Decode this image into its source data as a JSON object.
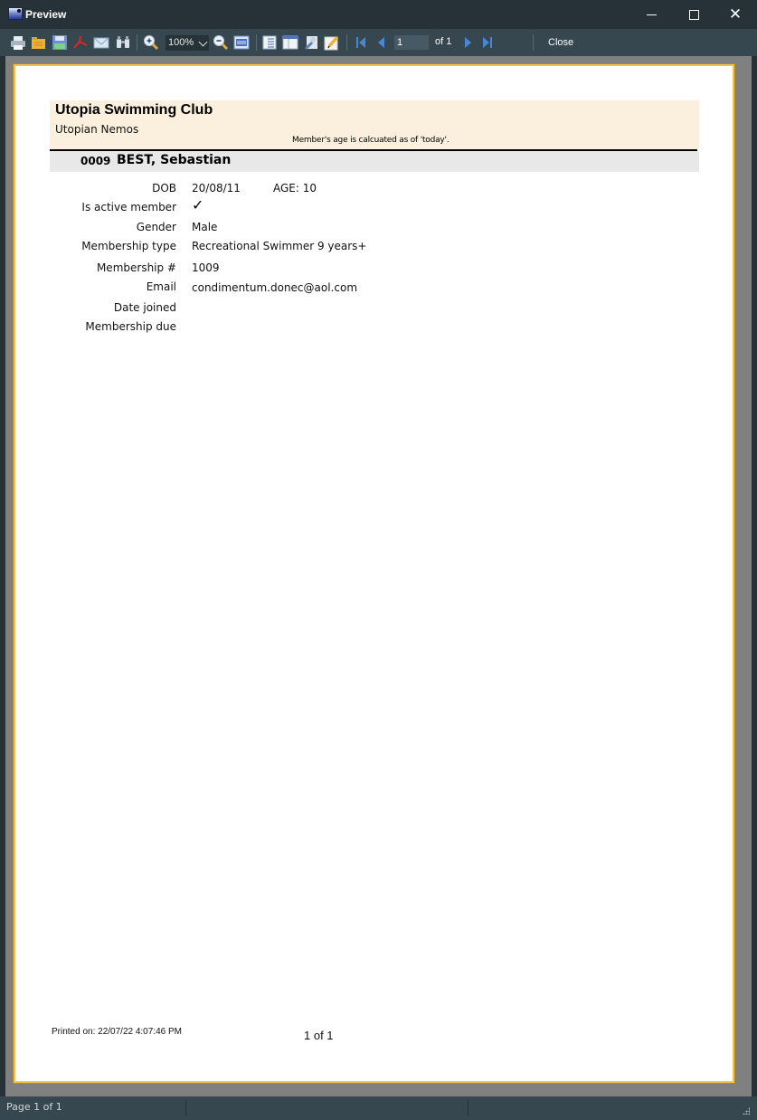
{
  "window": {
    "title": "Preview",
    "controls": {
      "minimize": "minimize",
      "maximize": "maximize",
      "close": "✕"
    }
  },
  "toolbar": {
    "buttons": [
      {
        "name": "print",
        "icon": "printer-icon"
      },
      {
        "name": "open",
        "icon": "folder-open-icon"
      },
      {
        "name": "save",
        "icon": "floppy-disk-icon"
      },
      {
        "name": "export-pdf",
        "icon": "pdf-icon"
      },
      {
        "name": "email",
        "icon": "envelope-icon"
      },
      {
        "name": "find",
        "icon": "binoculars-icon"
      },
      {
        "name": "zoom-in",
        "icon": "zoom-in-icon"
      },
      {
        "name": "zoom-out",
        "icon": "zoom-out-icon"
      },
      {
        "name": "page-width",
        "icon": "page-width-icon"
      },
      {
        "name": "outline",
        "icon": "outline-icon"
      },
      {
        "name": "page-setup",
        "icon": "page-setup-icon"
      },
      {
        "name": "design",
        "icon": "wrench-icon"
      },
      {
        "name": "edit",
        "icon": "pencil-icon"
      },
      {
        "name": "first-page",
        "icon": "first-page-icon"
      },
      {
        "name": "previous-page",
        "icon": "previous-page-icon"
      },
      {
        "name": "next-page",
        "icon": "next-page-icon"
      },
      {
        "name": "last-page",
        "icon": "last-page-icon"
      }
    ],
    "zoom_level": "100%",
    "current_page": "1",
    "of_pages": "of 1",
    "close_label": "Close"
  },
  "report": {
    "club_name": "Utopia Swimming Club",
    "club_subtitle": "Utopian Nemos",
    "age_note": "Member's age is calcuated as of 'today'.",
    "member": {
      "id": "0009",
      "name": "BEST, Sebastian",
      "age_label": "AGE: 10",
      "fields": [
        {
          "label": "DOB",
          "value": "20/08/11"
        },
        {
          "label": "Is active member",
          "value": "✓"
        },
        {
          "label": "Gender",
          "value": "Male"
        },
        {
          "label": "Membership type",
          "value": "Recreational Swimmer 9 years+"
        },
        {
          "label": "Membership #",
          "value": "1009"
        },
        {
          "label": "Email",
          "value": "condimentum.donec@aol.com"
        },
        {
          "label": "Date joined",
          "value": ""
        },
        {
          "label": "Membership due",
          "value": ""
        }
      ]
    },
    "footer": {
      "printed_on": "Printed on: 22/07/22 4:07:46 PM",
      "page_of": "1 of 1"
    }
  },
  "statusbar": {
    "page_text": "Page 1 of 1"
  },
  "colors": {
    "chrome_dark": "#263238",
    "chrome_mid": "#37474f",
    "page_border": "#f2c14e",
    "header_band": "#fbf0dd",
    "member_band": "#e8e8e8"
  }
}
